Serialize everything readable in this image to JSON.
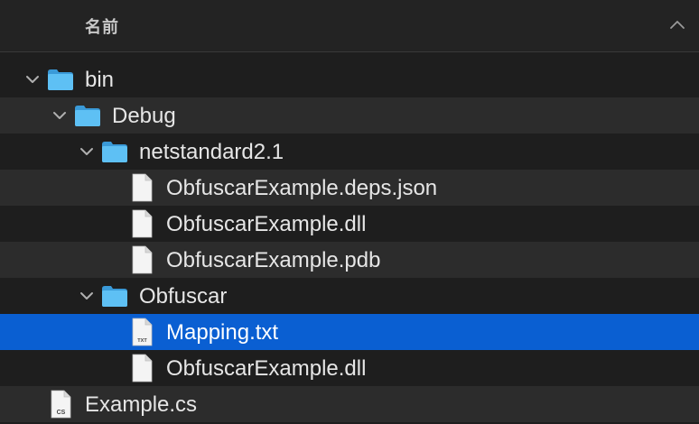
{
  "header": {
    "column_label": "名前"
  },
  "rows": [
    {
      "label": "bin",
      "kind": "folder",
      "expanded": true
    },
    {
      "label": "Debug",
      "kind": "folder",
      "expanded": true
    },
    {
      "label": "netstandard2.1",
      "kind": "folder",
      "expanded": true
    },
    {
      "label": "ObfuscarExample.deps.json",
      "kind": "file"
    },
    {
      "label": "ObfuscarExample.dll",
      "kind": "file"
    },
    {
      "label": "ObfuscarExample.pdb",
      "kind": "file"
    },
    {
      "label": "Obfuscar",
      "kind": "folder",
      "expanded": true
    },
    {
      "label": "Mapping.txt",
      "kind": "file",
      "selected": true,
      "badge": "TXT"
    },
    {
      "label": "ObfuscarExample.dll",
      "kind": "file"
    },
    {
      "label": "Example.cs",
      "kind": "file",
      "badge": "CS"
    }
  ],
  "colors": {
    "background": "#1e1e1e",
    "stripe": "#2c2c2c",
    "selection": "#0a5fd2",
    "folder": "#4fb4f0",
    "text": "#e6e6e6"
  }
}
